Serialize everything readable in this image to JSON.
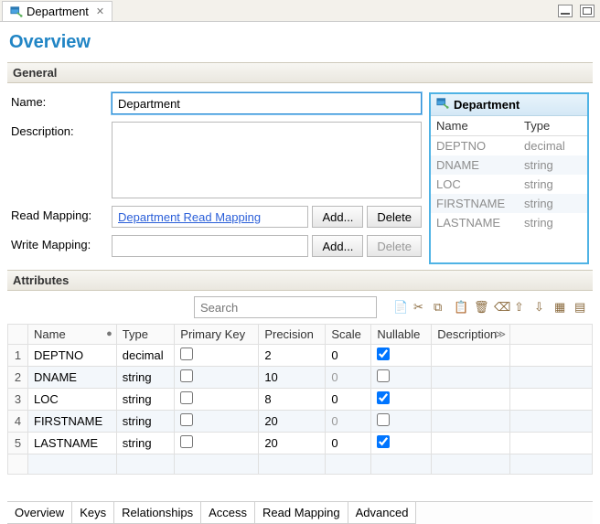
{
  "titlebar": {
    "tab_label": "Department"
  },
  "page_title": "Overview",
  "sections": {
    "general": "General",
    "attributes": "Attributes"
  },
  "general": {
    "name_label": "Name:",
    "name_value": "Department",
    "description_label": "Description:",
    "description_value": "",
    "read_mapping_label": "Read Mapping:",
    "read_mapping_link": "Department Read Mapping",
    "write_mapping_label": "Write Mapping:",
    "write_mapping_value": "",
    "add_btn": "Add...",
    "delete_btn": "Delete"
  },
  "sidepanel": {
    "title": "Department",
    "col_name": "Name",
    "col_type": "Type",
    "rows": [
      {
        "name": "DEPTNO",
        "type": "decimal"
      },
      {
        "name": "DNAME",
        "type": "string"
      },
      {
        "name": "LOC",
        "type": "string"
      },
      {
        "name": "FIRSTNAME",
        "type": "string"
      },
      {
        "name": "LASTNAME",
        "type": "string"
      }
    ]
  },
  "attributes": {
    "search_placeholder": "Search",
    "columns": {
      "name": "Name",
      "type": "Type",
      "pk": "Primary Key",
      "precision": "Precision",
      "scale": "Scale",
      "nullable": "Nullable",
      "description": "Description"
    },
    "rows": [
      {
        "n": "1",
        "name": "DEPTNO",
        "type": "decimal",
        "pk": false,
        "precision": "2",
        "scale": "0",
        "scale_grey": false,
        "nullable": true,
        "description": ""
      },
      {
        "n": "2",
        "name": "DNAME",
        "type": "string",
        "pk": false,
        "precision": "10",
        "scale": "0",
        "scale_grey": true,
        "nullable": false,
        "description": ""
      },
      {
        "n": "3",
        "name": "LOC",
        "type": "string",
        "pk": false,
        "precision": "8",
        "scale": "0",
        "scale_grey": false,
        "nullable": true,
        "description": ""
      },
      {
        "n": "4",
        "name": "FIRSTNAME",
        "type": "string",
        "pk": false,
        "precision": "20",
        "scale": "0",
        "scale_grey": true,
        "nullable": false,
        "description": ""
      },
      {
        "n": "5",
        "name": "LASTNAME",
        "type": "string",
        "pk": false,
        "precision": "20",
        "scale": "0",
        "scale_grey": false,
        "nullable": true,
        "description": ""
      }
    ]
  },
  "bottom_tabs": [
    "Overview",
    "Keys",
    "Relationships",
    "Access",
    "Read Mapping",
    "Advanced"
  ],
  "toolbar_icons": [
    "new",
    "cut",
    "copy",
    "paste",
    "delete",
    "trash",
    "up",
    "down",
    "grid1",
    "grid2"
  ]
}
